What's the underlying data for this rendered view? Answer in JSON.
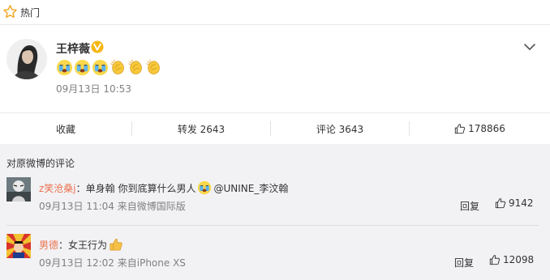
{
  "hot": {
    "label": "热门",
    "icon": "star-outline-icon"
  },
  "post": {
    "author": "王梓薇",
    "badge": "verified-v-icon",
    "emojis": [
      "crying-emoji-icon",
      "crying-emoji-icon",
      "crying-emoji-icon",
      "clapping-hands-icon",
      "clapping-hands-icon",
      "clapping-hands-icon"
    ],
    "time": "09月13日 10:53",
    "menu_icon": "chevron-down-icon"
  },
  "actions": {
    "favorite": "收藏",
    "repost": "转发 2643",
    "comment": "评论 3643",
    "like_count": "178866"
  },
  "comments": {
    "title": "对原微博的评论",
    "items": [
      {
        "user": "z笑沧桑j",
        "colon": "：",
        "text_before": "单身翰 你到底算什么男人",
        "mention": "@UNINE_李汶翰",
        "meta": "09月13日 11:04 来自微博国际版",
        "reply": "回复",
        "likes": "9142"
      },
      {
        "user": "男德",
        "colon": "：",
        "text_before": "女王行为",
        "mention": "",
        "meta": "09月13日 12:02 来自iPhone XS",
        "reply": "回复",
        "likes": "12098"
      }
    ]
  },
  "colors": {
    "username": "#eb7350",
    "badge": "#f6b512",
    "muted": "#808080",
    "background": "#f2f2f5"
  }
}
